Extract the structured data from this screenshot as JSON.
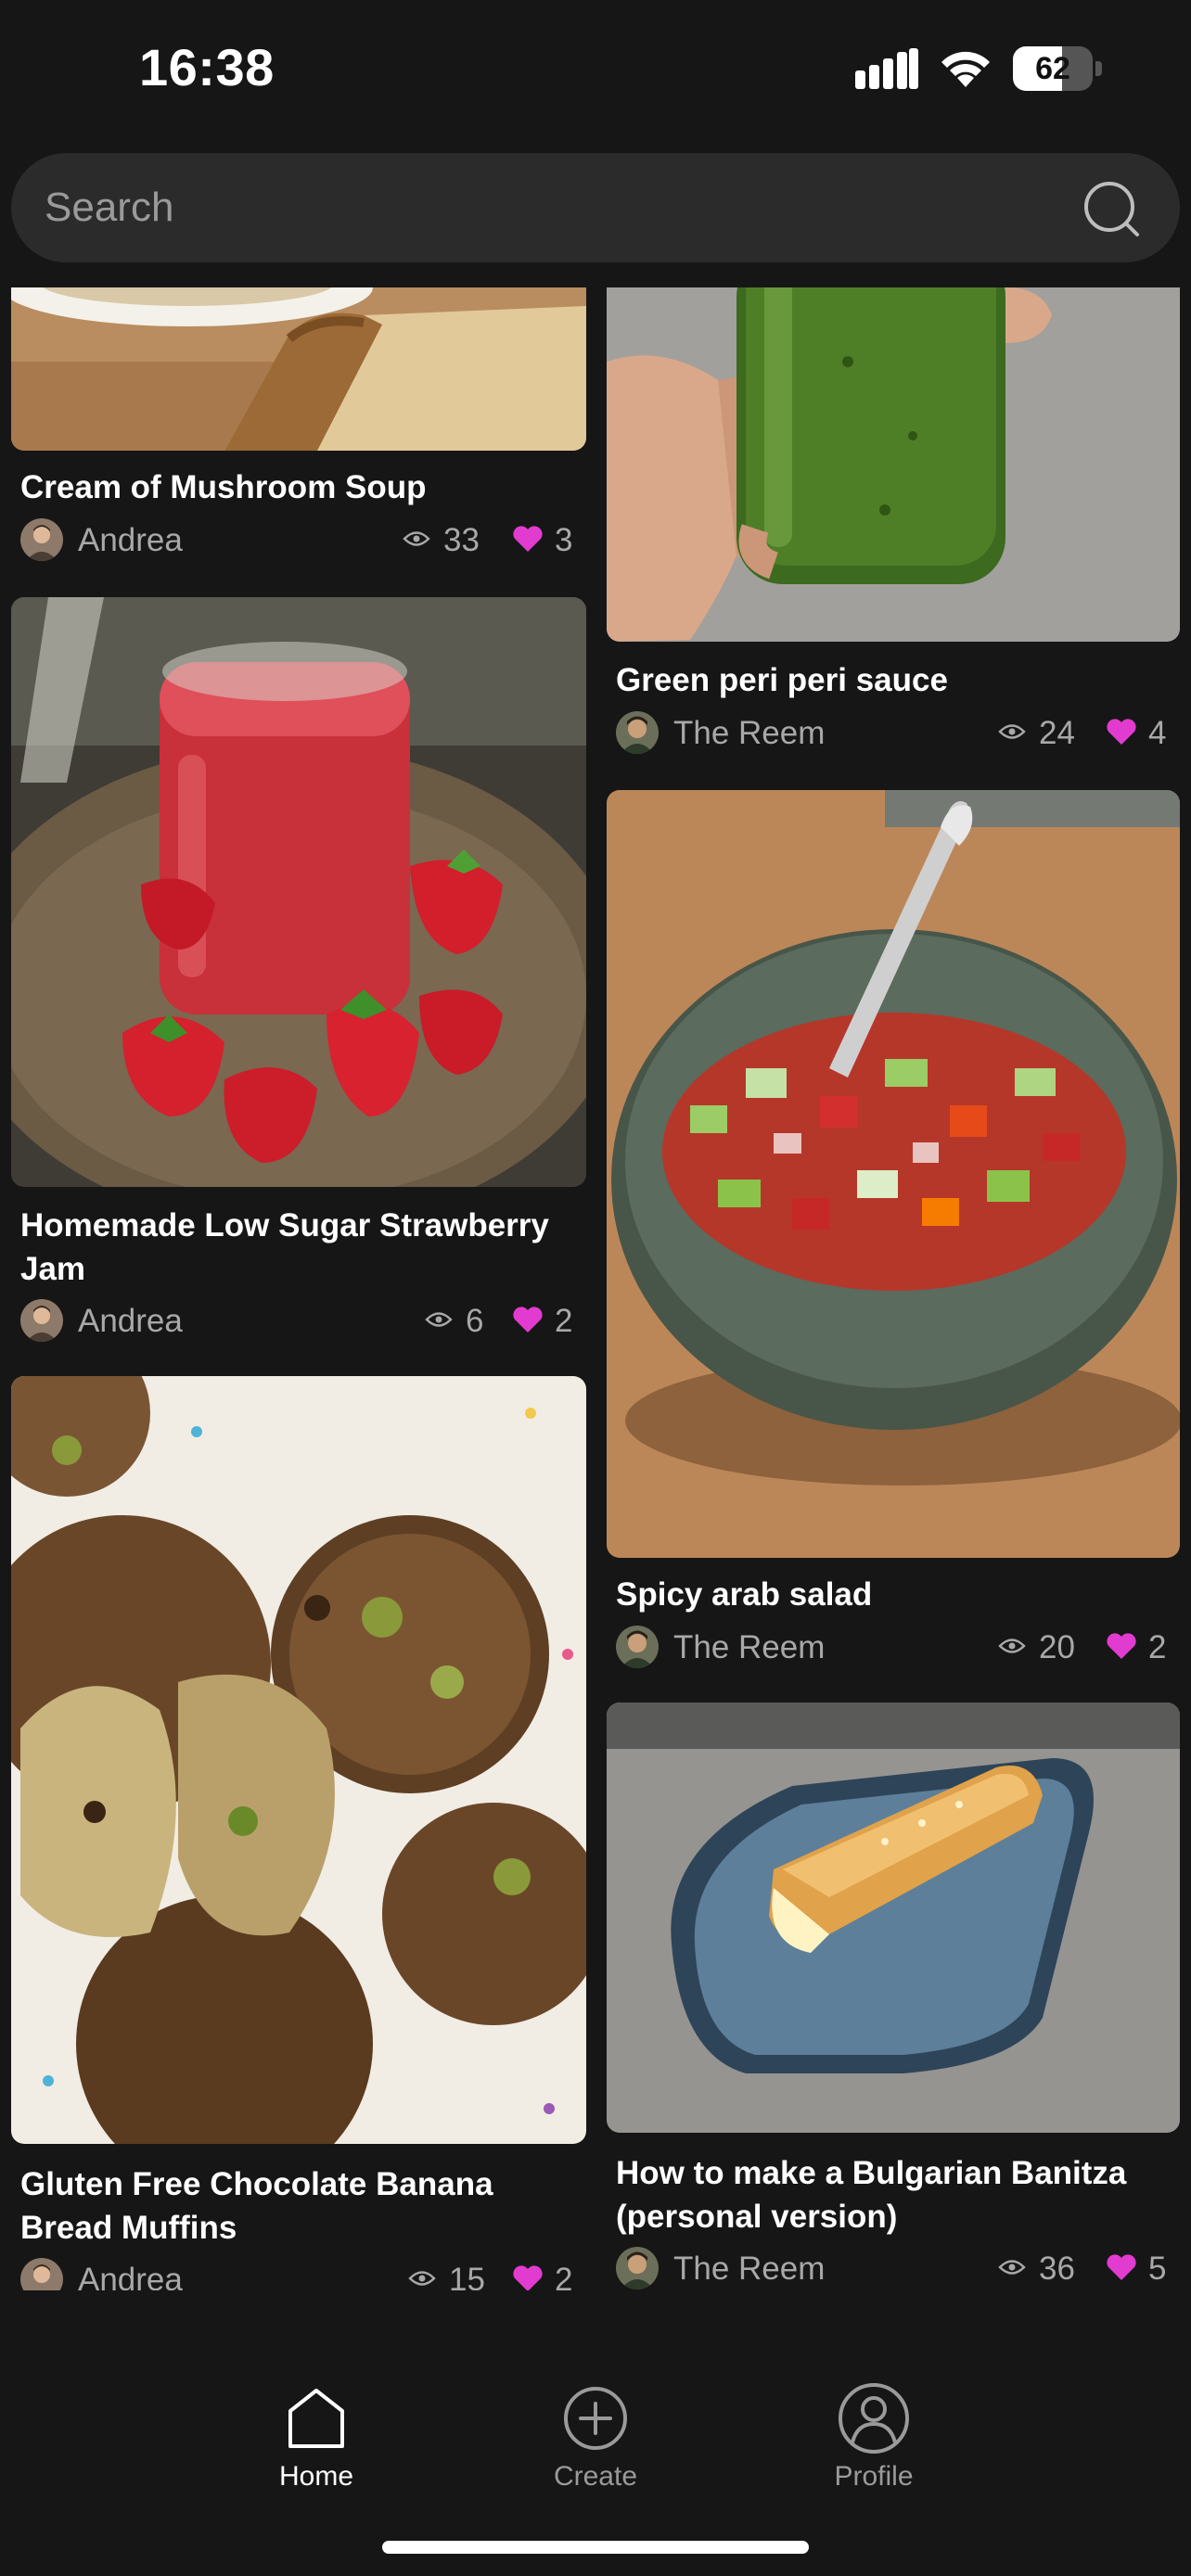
{
  "status_bar": {
    "time": "16:38",
    "battery": "62",
    "battery_level": 0.62
  },
  "search": {
    "placeholder": "Search",
    "value": ""
  },
  "feed": {
    "left_column": [
      {
        "title": "Cream of Mushroom Soup",
        "author": "Andrea",
        "views": "33",
        "likes": "3",
        "image": "mushroom-soup-with-bread"
      },
      {
        "title": "Homemade Low Sugar Strawberry Jam",
        "author": "Andrea",
        "views": "6",
        "likes": "2",
        "image": "strawberry-jam-jar"
      },
      {
        "title": "Gluten Free Chocolate Banana Bread Muffins",
        "author": "Andrea",
        "views": "15",
        "likes": "2",
        "image": "banana-bread-muffins"
      }
    ],
    "right_column": [
      {
        "title": "Green peri peri sauce",
        "author": "The Reem",
        "views": "24",
        "likes": "4",
        "image": "green-sauce-jar"
      },
      {
        "title": "Spicy arab salad",
        "author": "The Reem",
        "views": "20",
        "likes": "2",
        "image": "chopped-salad-bowl"
      },
      {
        "title": "How to make a Bulgarian Banitza (personal version)",
        "author": "The Reem",
        "views": "36",
        "likes": "5",
        "image": "banitza-on-plate"
      }
    ]
  },
  "tabbar": {
    "tabs": [
      {
        "label": "Home",
        "icon": "home-icon",
        "active": true
      },
      {
        "label": "Create",
        "icon": "plus-circle-icon",
        "active": false
      },
      {
        "label": "Profile",
        "icon": "profile-icon",
        "active": false
      }
    ]
  },
  "colors": {
    "background": "#161616",
    "accent_heart": "#e23bd0",
    "muted_text": "#a8a8a8",
    "search_bg": "#2b2b2b"
  }
}
